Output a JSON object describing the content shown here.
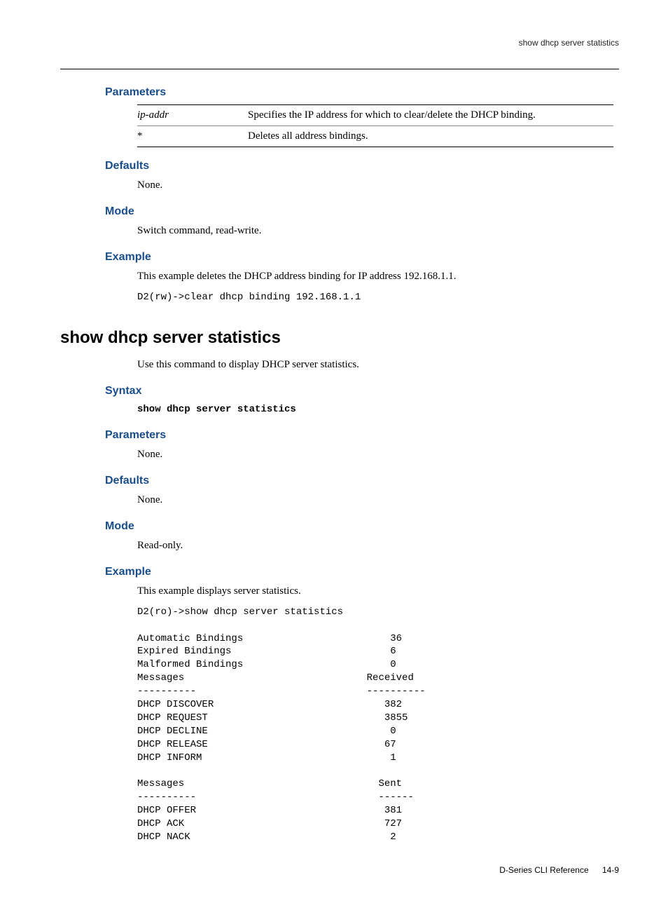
{
  "running_head": "show dhcp server statistics",
  "sec1": {
    "parameters_label": "Parameters",
    "param_rows": [
      {
        "name": "ip-addr",
        "italic": true,
        "desc": "Specifies the IP address for which to clear/delete the DHCP binding."
      },
      {
        "name": "*",
        "italic": false,
        "desc": "Deletes all address bindings."
      }
    ],
    "defaults_label": "Defaults",
    "defaults_text": "None.",
    "mode_label": "Mode",
    "mode_text": "Switch command, read-write.",
    "example_label": "Example",
    "example_text": "This example deletes the DHCP address binding for IP address 192.168.1.1.",
    "example_cmd": "D2(rw)->clear dhcp binding 192.168.1.1"
  },
  "cmd_heading": "show dhcp server statistics",
  "cmd_intro": "Use this command to display DHCP server statistics.",
  "sec2": {
    "syntax_label": "Syntax",
    "syntax_cmd": "show dhcp server statistics",
    "parameters_label": "Parameters",
    "parameters_text": "None.",
    "defaults_label": "Defaults",
    "defaults_text": "None.",
    "mode_label": "Mode",
    "mode_text": "Read-only.",
    "example_label": "Example",
    "example_text": "This example displays server statistics.",
    "example_output": "D2(ro)->show dhcp server statistics\n\nAutomatic Bindings                         36\nExpired Bindings                           6\nMalformed Bindings                         0\nMessages                               Received\n----------                             ----------\nDHCP DISCOVER                             382\nDHCP REQUEST                              3855\nDHCP DECLINE                               0\nDHCP RELEASE                              67\nDHCP INFORM                                1\n\nMessages                                 Sent\n----------                               ------\nDHCP OFFER                                381\nDHCP ACK                                  727\nDHCP NACK                                  2"
  },
  "footer_doc": "D-Series CLI Reference",
  "footer_page": "14-9"
}
